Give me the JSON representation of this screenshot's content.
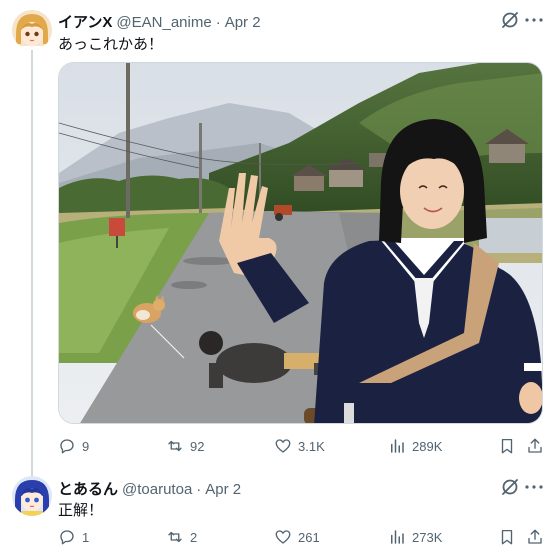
{
  "tweets": [
    {
      "display_name": "イアンX",
      "handle": "@EAN_anime",
      "separator": "·",
      "date": "Apr 2",
      "text": "あっこれかあ！",
      "stats": {
        "replies": "9",
        "reposts": "92",
        "likes": "3.1K",
        "views": "289K"
      }
    },
    {
      "display_name": "とあるん",
      "handle": "@toarutoa",
      "separator": "·",
      "date": "Apr 2",
      "text": "正解！",
      "stats": {
        "replies": "1",
        "reposts": "2",
        "likes": "261",
        "views": "273K"
      }
    }
  ],
  "icons": {
    "reply": "reply-icon",
    "repost": "repost-icon",
    "like": "heart-icon",
    "views": "views-chart-icon",
    "bookmark": "bookmark-icon",
    "share": "share-icon",
    "grok": "grok-icon"
  },
  "colors": {
    "text": "#0f1419",
    "secondary": "#536471",
    "border": "#cfd9de"
  }
}
